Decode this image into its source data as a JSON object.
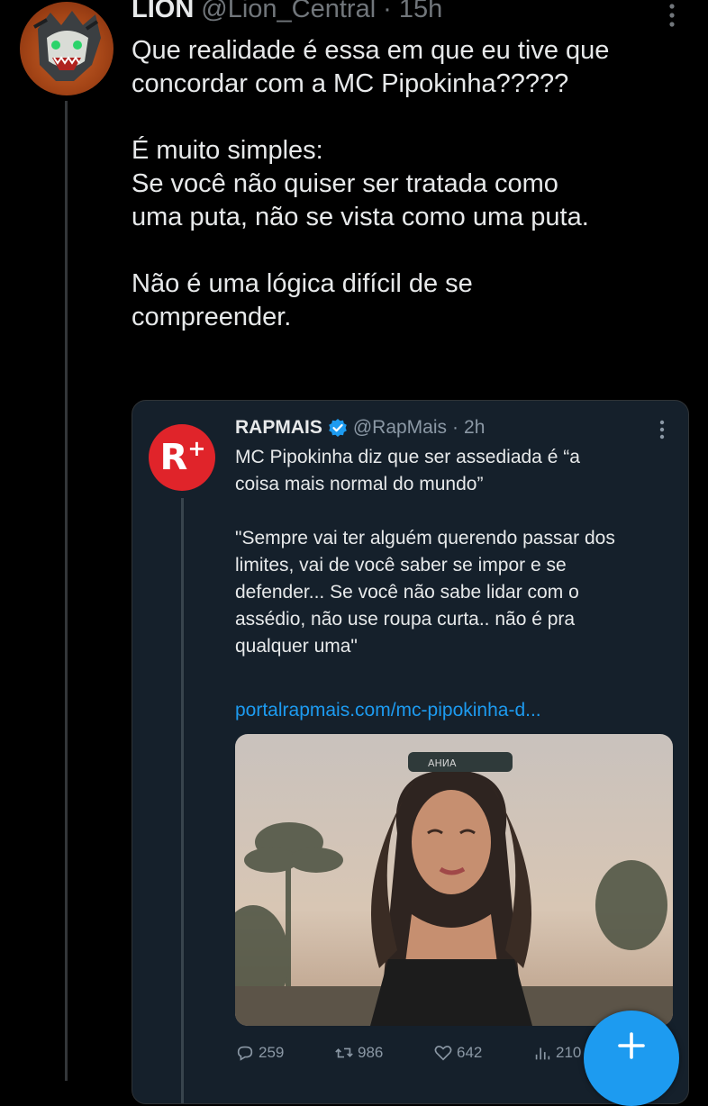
{
  "tweet": {
    "author": {
      "display_name": "LION",
      "handle": "@Lion_Central",
      "separator": "·",
      "time": "15h"
    },
    "text_paragraphs": [
      [
        "Que realidade é essa em que eu tive que",
        "concordar com a MC Pipokinha?????"
      ],
      [
        "É muito simples:",
        "Se você não quiser ser tratada como",
        "uma puta, não se vista como uma puta."
      ],
      [
        "Não é uma lógica difícil de se",
        "compreender."
      ]
    ],
    "icons": {
      "avatar": "lion-avatar-icon",
      "more": "more-vertical-icon"
    }
  },
  "quote": {
    "author": {
      "avatar_text": "R",
      "avatar_plus": "+",
      "display_name": "RAPMAIS",
      "handle": "@RapMais",
      "separator": "·",
      "time": "2h"
    },
    "text_lines": {
      "headline": [
        "MC Pipokinha diz que ser assediada é “a",
        "coisa mais normal do mundo”"
      ],
      "quote": [
        "\"Sempre vai ter alguém querendo passar dos",
        "limites, vai de você saber se impor e se",
        "defender... Se você não sabe lidar com o",
        "assédio, não use roupa curta.. não é pra",
        "qualquer uma\""
      ]
    },
    "link": "portalrapmais.com/mc-pipokinha-d...",
    "image_sunglasses_text": "AНИA",
    "actions": {
      "replies": "259",
      "retweets": "986",
      "likes": "642",
      "views": "210"
    },
    "colors": {
      "card_bg": "#15202b",
      "brand_red": "#e0242a",
      "link_blue": "#1d9bf0"
    }
  },
  "fab": {
    "icon": "plus-icon",
    "color": "#1d9bf0"
  }
}
